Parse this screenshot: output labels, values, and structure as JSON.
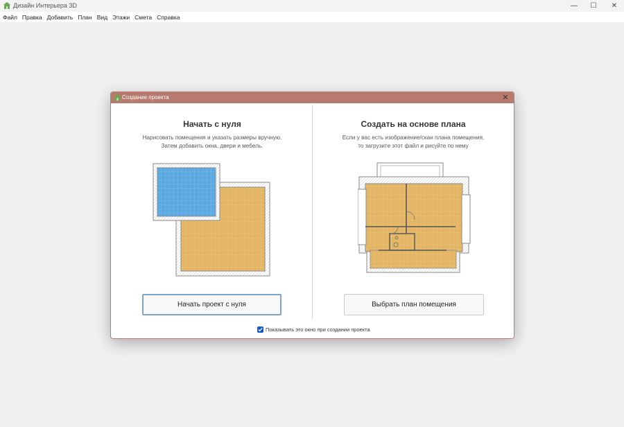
{
  "window": {
    "title": "Дизайн Интерьера 3D",
    "controls": {
      "minimize": "—",
      "maximize": "☐",
      "close": "✕"
    }
  },
  "menu": {
    "items": [
      "Файл",
      "Правка",
      "Добавить",
      "План",
      "Вид",
      "Этажи",
      "Смета",
      "Справка"
    ]
  },
  "dialog": {
    "title": "Создание проекта",
    "close": "✕",
    "left": {
      "heading": "Начать с нуля",
      "desc_line1": "Нарисовать помещения и указать размеры вручную.",
      "desc_line2": "Затем добавить окна, двери и мебель.",
      "button": "Начать проект с нуля"
    },
    "right": {
      "heading": "Создать на основе плана",
      "desc_line1": "Если у вас есть изображение/скан плана помещения,",
      "desc_line2": "то загрузите этот файл и рисуйте по нему",
      "button": "Выбрать план помещения"
    },
    "checkbox": {
      "label": "Показывать это окно при создании проекта",
      "checked": true
    }
  },
  "colors": {
    "accent": "#b77a6e",
    "floor_orange": "#e4b563",
    "floor_blue": "#5aa9e2",
    "checkbox": "#0d5bd3"
  }
}
